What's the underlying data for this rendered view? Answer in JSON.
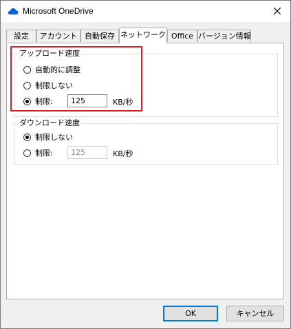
{
  "window": {
    "title": "Microsoft OneDrive",
    "icon": "onedrive-cloud-icon",
    "close": "close-icon",
    "accent": "#0078d7",
    "highlight_color": "#d81e2a"
  },
  "tabs": [
    {
      "label": "設定",
      "active": false
    },
    {
      "label": "アカウント",
      "active": false
    },
    {
      "label": "自動保存",
      "active": false
    },
    {
      "label": "ネットワーク",
      "active": true
    },
    {
      "label": "Office",
      "active": false
    },
    {
      "label": "バージョン情報",
      "active": false
    }
  ],
  "upload": {
    "legend": "アップロード速度",
    "options": [
      {
        "label": "自動的に調整",
        "checked": false
      },
      {
        "label": "制限しない",
        "checked": false
      },
      {
        "label": "制限:",
        "checked": true
      }
    ],
    "limit_value": "125",
    "unit": "KB/秒"
  },
  "download": {
    "legend": "ダウンロード速度",
    "options": [
      {
        "label": "制限しない",
        "checked": true
      },
      {
        "label": "制限:",
        "checked": false
      }
    ],
    "limit_value": "125",
    "unit": "KB/秒"
  },
  "buttons": {
    "ok": "OK",
    "cancel": "キャンセル"
  }
}
